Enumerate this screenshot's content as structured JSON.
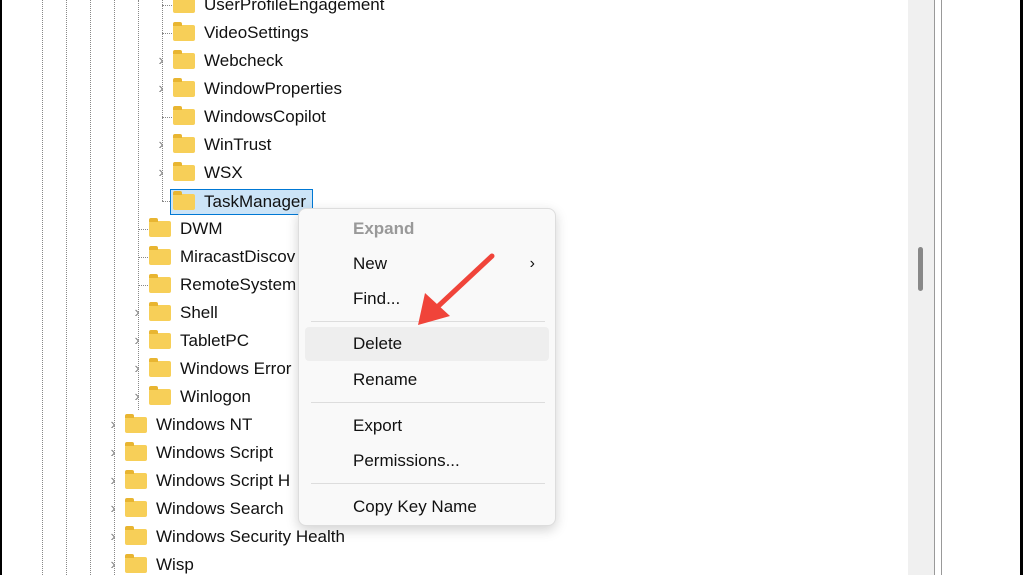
{
  "tree": {
    "items": [
      {
        "label": "UserProfileEngagement",
        "level": 2,
        "expandable": false
      },
      {
        "label": "VideoSettings",
        "level": 2,
        "expandable": false
      },
      {
        "label": "Webcheck",
        "level": 2,
        "expandable": true
      },
      {
        "label": "WindowProperties",
        "level": 2,
        "expandable": true
      },
      {
        "label": "WindowsCopilot",
        "level": 2,
        "expandable": false
      },
      {
        "label": "WinTrust",
        "level": 2,
        "expandable": true
      },
      {
        "label": "WSX",
        "level": 2,
        "expandable": true
      },
      {
        "label": "TaskManager",
        "level": 2,
        "expandable": false,
        "selected": true
      },
      {
        "label": "DWM",
        "level": 1,
        "expandable": false
      },
      {
        "label": "MiracastDiscov",
        "level": 1,
        "expandable": false
      },
      {
        "label": "RemoteSystem",
        "level": 1,
        "expandable": false
      },
      {
        "label": "Shell",
        "level": 1,
        "expandable": true
      },
      {
        "label": "TabletPC",
        "level": 1,
        "expandable": true
      },
      {
        "label": "Windows Error",
        "level": 1,
        "expandable": true
      },
      {
        "label": "Winlogon",
        "level": 1,
        "expandable": true
      },
      {
        "label": "Windows NT",
        "level": 0,
        "expandable": true
      },
      {
        "label": "Windows Script",
        "level": 0,
        "expandable": true
      },
      {
        "label": "Windows Script H",
        "level": 0,
        "expandable": true
      },
      {
        "label": "Windows Search",
        "level": 0,
        "expandable": true
      },
      {
        "label": "Windows Security Health",
        "level": 0,
        "expandable": true
      },
      {
        "label": "Wisp",
        "level": 0,
        "expandable": true
      }
    ]
  },
  "context_menu": {
    "items": [
      {
        "label": "Expand",
        "disabled": true
      },
      {
        "label": "New",
        "submenu": true
      },
      {
        "label": "Find..."
      },
      {
        "label": "Delete",
        "highlighted": true
      },
      {
        "label": "Rename"
      },
      {
        "label": "Export"
      },
      {
        "label": "Permissions..."
      },
      {
        "label": "Copy Key Name"
      }
    ]
  },
  "annotation": {
    "arrow_color": "#f0443a"
  }
}
